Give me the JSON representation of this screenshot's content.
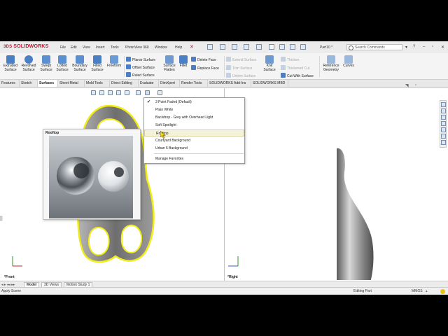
{
  "app": {
    "brand": "SOLIDWORKS",
    "brand_prefix": "3DS",
    "document": "Part10 *",
    "search_placeholder": "Search Commands"
  },
  "menus": [
    "File",
    "Edit",
    "View",
    "Insert",
    "Tools",
    "PhotoView 360",
    "Window",
    "Help"
  ],
  "ribbon": {
    "big_buttons": [
      {
        "label": "Extruded Surface",
        "icon": "extruded-surface-icon",
        "color": "#3f78c2"
      },
      {
        "label": "Revolved Surface",
        "icon": "revolved-surface-icon",
        "color": "#3f78c2"
      },
      {
        "label": "Swept Surface",
        "icon": "swept-surface-icon",
        "color": "#3f78c2"
      },
      {
        "label": "Lofted Surface",
        "icon": "lofted-surface-icon",
        "color": "#3f78c2"
      },
      {
        "label": "Boundary Surface",
        "icon": "boundary-surface-icon",
        "color": "#3f78c2"
      },
      {
        "label": "Filled Surface",
        "icon": "filled-surface-icon",
        "color": "#3f78c2"
      },
      {
        "label": "Freeform",
        "icon": "freeform-icon",
        "color": "#3f78c2"
      }
    ],
    "col1": [
      "Planar Surface",
      "Offset Surface",
      "Ruled Surface"
    ],
    "surface_flatten": "Surface Flatten",
    "fillet": "Fillet",
    "col2": [
      "Delete Face",
      "Replace Face"
    ],
    "col3_disabled": [
      "Extend Surface",
      "Trim Surface",
      "Untrim Surface"
    ],
    "knit": "Knit Surface",
    "col4_disabled": [
      "Thicken",
      "Thickened Cut"
    ],
    "cut_with_surface": "Cut With Surface",
    "reference_geometry": "Reference Geometry",
    "curves": "Curves"
  },
  "tabs": [
    "Features",
    "Sketch",
    "Surfaces",
    "Sheet Metal",
    "Mold Tools",
    "Direct Editing",
    "Evaluate",
    "DimXpert",
    "Render Tools",
    "SOLIDWORKS Add-Ins",
    "SOLIDWORKS MBD"
  ],
  "active_tab": "Surfaces",
  "scene_menu": {
    "items": [
      {
        "label": "3 Point Faded  (Default)",
        "checked": true
      },
      {
        "label": "Plain White"
      },
      {
        "label": "Backdrop - Grey with Overhead Light"
      },
      {
        "label": "Soft Spotlight"
      },
      {
        "label": "Rooftop",
        "highlighted": true
      },
      {
        "label": "Courtyard Background"
      },
      {
        "label": "Urban 5 Background"
      }
    ],
    "manage": "Manage Favorites"
  },
  "preview": {
    "title": "Rooftop"
  },
  "viewports": {
    "left_label": "*Front",
    "right_label": "*Right"
  },
  "bottom_tabs": [
    "Model",
    "3D Views",
    "Motion Study 1"
  ],
  "active_bottom_tab": "Model",
  "status": {
    "left": "Apply Scene",
    "mode": "Editing Part",
    "units": "MMGS"
  },
  "colors": {
    "selection_yellow": "#f2ec16",
    "model_grey": "#8c8c8c",
    "brand_red": "#c8102e"
  }
}
